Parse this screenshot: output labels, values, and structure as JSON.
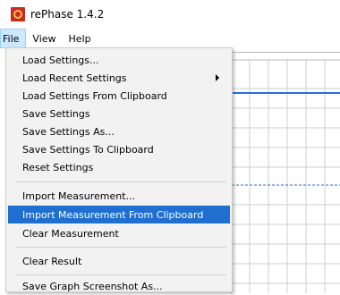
{
  "window": {
    "title": "rePhase 1.4.2",
    "icon": "rephase-app-icon"
  },
  "menubar": {
    "items": [
      {
        "label": "File",
        "active": true
      },
      {
        "label": "View",
        "active": false
      },
      {
        "label": "Help",
        "active": false
      }
    ]
  },
  "file_menu": {
    "items": [
      {
        "label": "Load Settings...",
        "has_submenu": false
      },
      {
        "label": "Load Recent Settings",
        "has_submenu": true
      },
      {
        "label": "Load Settings From Clipboard",
        "has_submenu": false
      },
      {
        "label": "Save Settings",
        "has_submenu": false
      },
      {
        "label": "Save Settings As...",
        "has_submenu": false
      },
      {
        "label": "Save Settings To Clipboard",
        "has_submenu": false
      },
      {
        "label": "Reset Settings",
        "has_submenu": false
      },
      {
        "label": "Import Measurement...",
        "has_submenu": false
      },
      {
        "label": "Import Measurement From Clipboard",
        "has_submenu": false,
        "highlighted": true
      },
      {
        "label": "Clear Measurement",
        "has_submenu": false
      },
      {
        "label": "Clear Result",
        "has_submenu": false
      },
      {
        "label": "Save Graph Screenshot As...",
        "has_submenu": false
      }
    ]
  },
  "colors": {
    "highlight": "#1f6fd1",
    "menu_hover_bg": "#cce8ff",
    "graph_line": "#2b6fd6",
    "grid": "#cfcfcf"
  }
}
